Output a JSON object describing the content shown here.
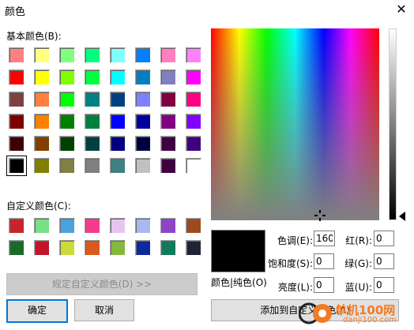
{
  "window": {
    "title": "颜色",
    "close_glyph": "✕"
  },
  "basic_colors": {
    "label": "基本颜色(B):",
    "swatches": [
      "#ff8080",
      "#ffff80",
      "#80ff80",
      "#00ff80",
      "#80ffff",
      "#0080ff",
      "#ff80c0",
      "#ff80ff",
      "#ff0000",
      "#ffff00",
      "#80ff00",
      "#00ff40",
      "#00ffff",
      "#0080c0",
      "#8080c0",
      "#ff00ff",
      "#804040",
      "#ff8040",
      "#00ff00",
      "#008080",
      "#004080",
      "#8080ff",
      "#800040",
      "#ff0080",
      "#800000",
      "#ff8000",
      "#008000",
      "#008040",
      "#0000ff",
      "#0000a0",
      "#800080",
      "#8000ff",
      "#400000",
      "#804000",
      "#004000",
      "#004040",
      "#000080",
      "#000040",
      "#400040",
      "#400080",
      "#000000",
      "#808000",
      "#808040",
      "#808080",
      "#408080",
      "#c0c0c0",
      "#400040",
      "#ffffff"
    ],
    "selected_index": 40
  },
  "custom_colors": {
    "label": "自定义颜色(C):",
    "swatches": [
      "#c8242c",
      "#76e08a",
      "#4aa3df",
      "#f53b8c",
      "#e8c3f0",
      "#a9b8ee",
      "#8f44c8",
      "#9c4a1b",
      "#196b2a",
      "#c0152b",
      "#cddb3a",
      "#da5a1d",
      "#83b93b",
      "#0f2a9e",
      "#107a5c",
      "#1f2336"
    ]
  },
  "buttons": {
    "define_custom": "规定自定义颜色(D) >>",
    "ok": "确定",
    "cancel": "取消",
    "add_custom": "添加到自定义颜色(A)"
  },
  "preview": {
    "label": "颜色|纯色(O)",
    "color": "#000000"
  },
  "fields": {
    "hue": {
      "label": "色调(E):",
      "value": "160"
    },
    "sat": {
      "label": "饱和度(S):",
      "value": "0"
    },
    "lum": {
      "label": "亮度(L):",
      "value": "0"
    },
    "red": {
      "label": "红(R):",
      "value": "0"
    },
    "green": {
      "label": "绿(G):",
      "value": "0"
    },
    "blue": {
      "label": "蓝(U):",
      "value": "0"
    }
  },
  "watermark": {
    "name": "单机100网",
    "url": "danji100.com"
  }
}
